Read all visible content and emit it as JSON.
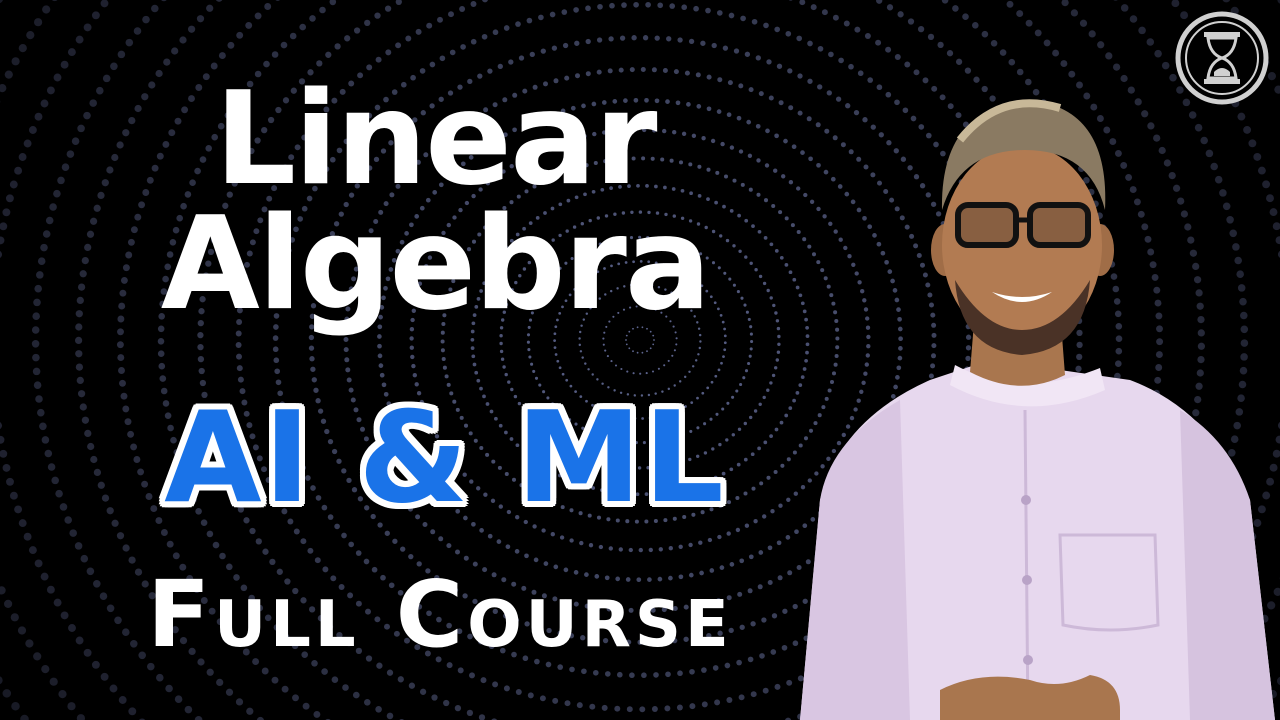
{
  "thumbnail": {
    "title_line1": "Linear",
    "title_line2": "Algebra",
    "subtitle": "AI & ML",
    "course_label": "Full Course"
  },
  "colors": {
    "background": "#000000",
    "title_text": "#ffffff",
    "subtitle_fill": "#1a73e8",
    "subtitle_outline": "#ffffff",
    "tunnel_dots": "#6f78a8",
    "shirt": "#e7d8ee"
  },
  "icons": {
    "logo": "hourglass-icon"
  }
}
